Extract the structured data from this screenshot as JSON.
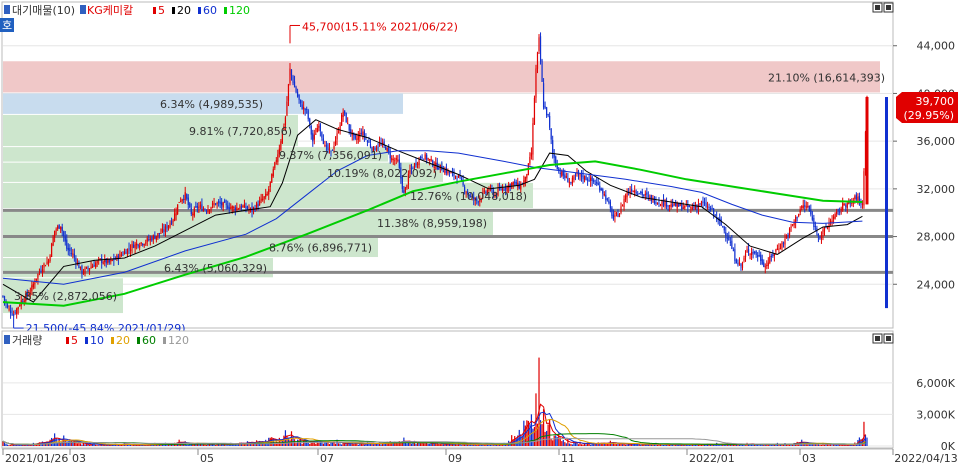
{
  "price_legend": {
    "prefix": "대기매물(10)",
    "stock_name": "KG케미칼",
    "ma": [
      {
        "label": "5",
        "color": "#e00000"
      },
      {
        "label": "20",
        "color": "#000000"
      },
      {
        "label": "60",
        "color": "#1030d0"
      },
      {
        "label": "120",
        "color": "#00cc00"
      }
    ]
  },
  "volume_legend": {
    "prefix": "거래량",
    "ma": [
      {
        "label": "5",
        "color": "#e00000"
      },
      {
        "label": "10",
        "color": "#1030d0"
      },
      {
        "label": "20",
        "color": "#e0a000"
      },
      {
        "label": "60",
        "color": "#008000"
      },
      {
        "label": "120",
        "color": "#999999"
      }
    ]
  },
  "side_tab": "호",
  "colors": {
    "up": "#e00000",
    "down": "#1030d0",
    "grid": "#e6e6e6",
    "zone": "#cde6cd",
    "zone_high": "#f0c8c8",
    "zone_blue": "#c8dcee"
  },
  "chart_data": {
    "type": "candlestick",
    "x_range": [
      "2021/01/26",
      "2022/04/13"
    ],
    "x_ticks": [
      "2021/01/26",
      "03",
      "05",
      "07",
      "09",
      "11",
      "2022/01",
      "03",
      "2022/04/13"
    ],
    "price_axis": {
      "ylim": [
        20500,
        47500
      ],
      "ticks": [
        "24,000",
        "28,000",
        "32,000",
        "36,000",
        "40,000",
        "44,000"
      ]
    },
    "volume_axis": {
      "ylim": [
        0,
        9500
      ],
      "ticks": [
        "0K",
        "3,000K",
        "6,000K"
      ]
    },
    "current_price": {
      "price": "39,700",
      "change": "(29.95%)"
    },
    "annotations": [
      {
        "text": "45,700(15.11% 2021/06/22)",
        "value": 45700,
        "kind": "high"
      },
      {
        "text": "21,500(-45.84% 2021/01/29)",
        "value": 21500,
        "kind": "low"
      }
    ],
    "support_lines": [
      30200,
      28000,
      25000
    ],
    "supply_zones": [
      {
        "label": "21.10% (16,614,393)",
        "low": 40000,
        "high": 42700,
        "style": "high"
      },
      {
        "label": "6.34% (4,989,535)",
        "low": 38200,
        "high": 40000,
        "style": "blue"
      },
      {
        "label": "9.81% (7,720,856)",
        "low": 35500,
        "high": 38200,
        "style": "zone"
      },
      {
        "label": "9.37% (7,356,091)",
        "low": 34200,
        "high": 35500,
        "style": "zone"
      },
      {
        "label": "10.19% (8,022,092)",
        "low": 32500,
        "high": 34200,
        "style": "zone"
      },
      {
        "label": "12.76% (10,048,018)",
        "low": 30300,
        "high": 32500,
        "style": "zone"
      },
      {
        "label": "11.38% (8,959,198)",
        "low": 28000,
        "high": 30300,
        "style": "zone"
      },
      {
        "label": "8.76% (6,896,771)",
        "low": 26200,
        "high": 28000,
        "style": "zone"
      },
      {
        "label": "6.43% (5,060,329)",
        "low": 24500,
        "high": 26200,
        "style": "zone"
      },
      {
        "label": "3.85% (2,872,056)",
        "low": 21500,
        "high": 24500,
        "style": "zone"
      }
    ],
    "price_path": [
      [
        0,
        23000
      ],
      [
        3,
        22000
      ],
      [
        7,
        21500
      ],
      [
        12,
        22600
      ],
      [
        18,
        23400
      ],
      [
        22,
        24600
      ],
      [
        26,
        25500
      ],
      [
        30,
        26000
      ],
      [
        34,
        28500
      ],
      [
        38,
        29000
      ],
      [
        42,
        27000
      ],
      [
        46,
        26500
      ],
      [
        52,
        25000
      ],
      [
        58,
        25500
      ],
      [
        64,
        26000
      ],
      [
        70,
        25800
      ],
      [
        78,
        26500
      ],
      [
        86,
        27300
      ],
      [
        94,
        27600
      ],
      [
        100,
        28000
      ],
      [
        106,
        28500
      ],
      [
        112,
        29500
      ],
      [
        116,
        31000
      ],
      [
        120,
        31500
      ],
      [
        124,
        29800
      ],
      [
        128,
        30500
      ],
      [
        134,
        30300
      ],
      [
        140,
        30800
      ],
      [
        146,
        30600
      ],
      [
        152,
        30400
      ],
      [
        158,
        30500
      ],
      [
        164,
        30200
      ],
      [
        170,
        31000
      ],
      [
        174,
        31500
      ],
      [
        178,
        33500
      ],
      [
        182,
        35500
      ],
      [
        186,
        38000
      ],
      [
        189,
        42000
      ],
      [
        192,
        40500
      ],
      [
        196,
        39000
      ],
      [
        200,
        38500
      ],
      [
        204,
        36000
      ],
      [
        208,
        37500
      ],
      [
        212,
        35500
      ],
      [
        216,
        35000
      ],
      [
        220,
        36500
      ],
      [
        224,
        38500
      ],
      [
        228,
        37000
      ],
      [
        232,
        36000
      ],
      [
        236,
        36800
      ],
      [
        240,
        36000
      ],
      [
        244,
        35300
      ],
      [
        248,
        35800
      ],
      [
        252,
        35500
      ],
      [
        256,
        34500
      ],
      [
        260,
        34300
      ],
      [
        264,
        31500
      ],
      [
        268,
        33500
      ],
      [
        272,
        34200
      ],
      [
        276,
        34800
      ],
      [
        280,
        34500
      ],
      [
        284,
        34000
      ],
      [
        288,
        33800
      ],
      [
        292,
        33500
      ],
      [
        296,
        33200
      ],
      [
        300,
        33000
      ],
      [
        304,
        32000
      ],
      [
        308,
        31300
      ],
      [
        312,
        31000
      ],
      [
        316,
        31500
      ],
      [
        320,
        32000
      ],
      [
        324,
        31500
      ],
      [
        328,
        32000
      ],
      [
        332,
        32200
      ],
      [
        336,
        32500
      ],
      [
        340,
        32200
      ],
      [
        344,
        32800
      ],
      [
        348,
        35000
      ],
      [
        351,
        42000
      ],
      [
        353,
        44500
      ],
      [
        356,
        39000
      ],
      [
        359,
        38000
      ],
      [
        362,
        35000
      ],
      [
        366,
        33500
      ],
      [
        370,
        33000
      ],
      [
        374,
        32500
      ],
      [
        378,
        33200
      ],
      [
        382,
        33000
      ],
      [
        386,
        32800
      ],
      [
        390,
        32500
      ],
      [
        394,
        32000
      ],
      [
        398,
        31000
      ],
      [
        402,
        29500
      ],
      [
        406,
        30000
      ],
      [
        410,
        31500
      ],
      [
        414,
        32000
      ],
      [
        418,
        31800
      ],
      [
        422,
        31500
      ],
      [
        426,
        31200
      ],
      [
        430,
        31000
      ],
      [
        436,
        30800
      ],
      [
        442,
        30600
      ],
      [
        448,
        30500
      ],
      [
        454,
        30400
      ],
      [
        460,
        30800
      ],
      [
        466,
        30300
      ],
      [
        470,
        29500
      ],
      [
        474,
        28800
      ],
      [
        478,
        27800
      ],
      [
        482,
        26200
      ],
      [
        486,
        25500
      ],
      [
        490,
        26800
      ],
      [
        494,
        26700
      ],
      [
        498,
        26300
      ],
      [
        502,
        25500
      ],
      [
        506,
        26300
      ],
      [
        510,
        27000
      ],
      [
        514,
        27500
      ],
      [
        518,
        28500
      ],
      [
        522,
        29500
      ],
      [
        526,
        30500
      ],
      [
        530,
        30500
      ],
      [
        534,
        29000
      ],
      [
        538,
        28000
      ],
      [
        542,
        28700
      ],
      [
        546,
        29500
      ],
      [
        550,
        30000
      ],
      [
        554,
        30800
      ],
      [
        558,
        30700
      ],
      [
        562,
        31300
      ],
      [
        566,
        30700
      ],
      [
        569,
        39700
      ]
    ],
    "ma_lines": [
      {
        "name": "MA20",
        "color": "#000000",
        "values": [
          [
            0,
            24000
          ],
          [
            20,
            22500
          ],
          [
            40,
            25500
          ],
          [
            60,
            26000
          ],
          [
            80,
            26200
          ],
          [
            100,
            27200
          ],
          [
            120,
            28500
          ],
          [
            140,
            29800
          ],
          [
            160,
            30200
          ],
          [
            176,
            30500
          ],
          [
            184,
            32500
          ],
          [
            194,
            36500
          ],
          [
            206,
            37800
          ],
          [
            220,
            37000
          ],
          [
            240,
            36300
          ],
          [
            260,
            35200
          ],
          [
            280,
            34200
          ],
          [
            300,
            33200
          ],
          [
            320,
            32000
          ],
          [
            340,
            32300
          ],
          [
            350,
            32800
          ],
          [
            360,
            35000
          ],
          [
            372,
            34800
          ],
          [
            384,
            33500
          ],
          [
            400,
            32300
          ],
          [
            420,
            31300
          ],
          [
            440,
            30900
          ],
          [
            460,
            30500
          ],
          [
            476,
            29000
          ],
          [
            492,
            27200
          ],
          [
            510,
            26500
          ],
          [
            526,
            27800
          ],
          [
            540,
            28800
          ],
          [
            556,
            29000
          ],
          [
            566,
            29700
          ]
        ]
      },
      {
        "name": "MA60",
        "color": "#1030d0",
        "values": [
          [
            0,
            24500
          ],
          [
            40,
            24000
          ],
          [
            80,
            25000
          ],
          [
            120,
            26800
          ],
          [
            160,
            28200
          ],
          [
            180,
            29500
          ],
          [
            200,
            31500
          ],
          [
            220,
            33500
          ],
          [
            240,
            34800
          ],
          [
            260,
            35200
          ],
          [
            280,
            35200
          ],
          [
            300,
            35000
          ],
          [
            330,
            34300
          ],
          [
            350,
            33800
          ],
          [
            380,
            33300
          ],
          [
            410,
            32800
          ],
          [
            440,
            32200
          ],
          [
            460,
            31700
          ],
          [
            480,
            30700
          ],
          [
            500,
            29800
          ],
          [
            520,
            29200
          ],
          [
            540,
            29100
          ],
          [
            566,
            29300
          ]
        ]
      },
      {
        "name": "MA120",
        "color": "#00cc00",
        "values": [
          [
            0,
            22500
          ],
          [
            40,
            22200
          ],
          [
            80,
            23200
          ],
          [
            120,
            24800
          ],
          [
            160,
            26300
          ],
          [
            200,
            28200
          ],
          [
            240,
            30200
          ],
          [
            270,
            31800
          ],
          [
            300,
            32600
          ],
          [
            330,
            33300
          ],
          [
            360,
            34000
          ],
          [
            390,
            34300
          ],
          [
            420,
            33600
          ],
          [
            450,
            32800
          ],
          [
            480,
            32200
          ],
          [
            510,
            31600
          ],
          [
            540,
            31000
          ],
          [
            566,
            30900
          ]
        ]
      }
    ],
    "volume_peaks": [
      [
        2,
        200
      ],
      [
        20,
        300
      ],
      [
        34,
        1200
      ],
      [
        40,
        1000
      ],
      [
        50,
        500
      ],
      [
        60,
        300
      ],
      [
        80,
        250
      ],
      [
        100,
        300
      ],
      [
        116,
        600
      ],
      [
        120,
        450
      ],
      [
        150,
        300
      ],
      [
        186,
        1500
      ],
      [
        190,
        1400
      ],
      [
        196,
        800
      ],
      [
        220,
        600
      ],
      [
        240,
        400
      ],
      [
        264,
        800
      ],
      [
        300,
        300
      ],
      [
        330,
        300
      ],
      [
        351,
        5000
      ],
      [
        353,
        8400
      ],
      [
        356,
        3500
      ],
      [
        360,
        2500
      ],
      [
        366,
        1200
      ],
      [
        372,
        700
      ],
      [
        380,
        400
      ],
      [
        400,
        500
      ],
      [
        430,
        300
      ],
      [
        470,
        300
      ],
      [
        490,
        300
      ],
      [
        510,
        300
      ],
      [
        526,
        600
      ],
      [
        540,
        300
      ],
      [
        560,
        200
      ],
      [
        567,
        2300
      ],
      [
        569,
        800
      ]
    ]
  }
}
